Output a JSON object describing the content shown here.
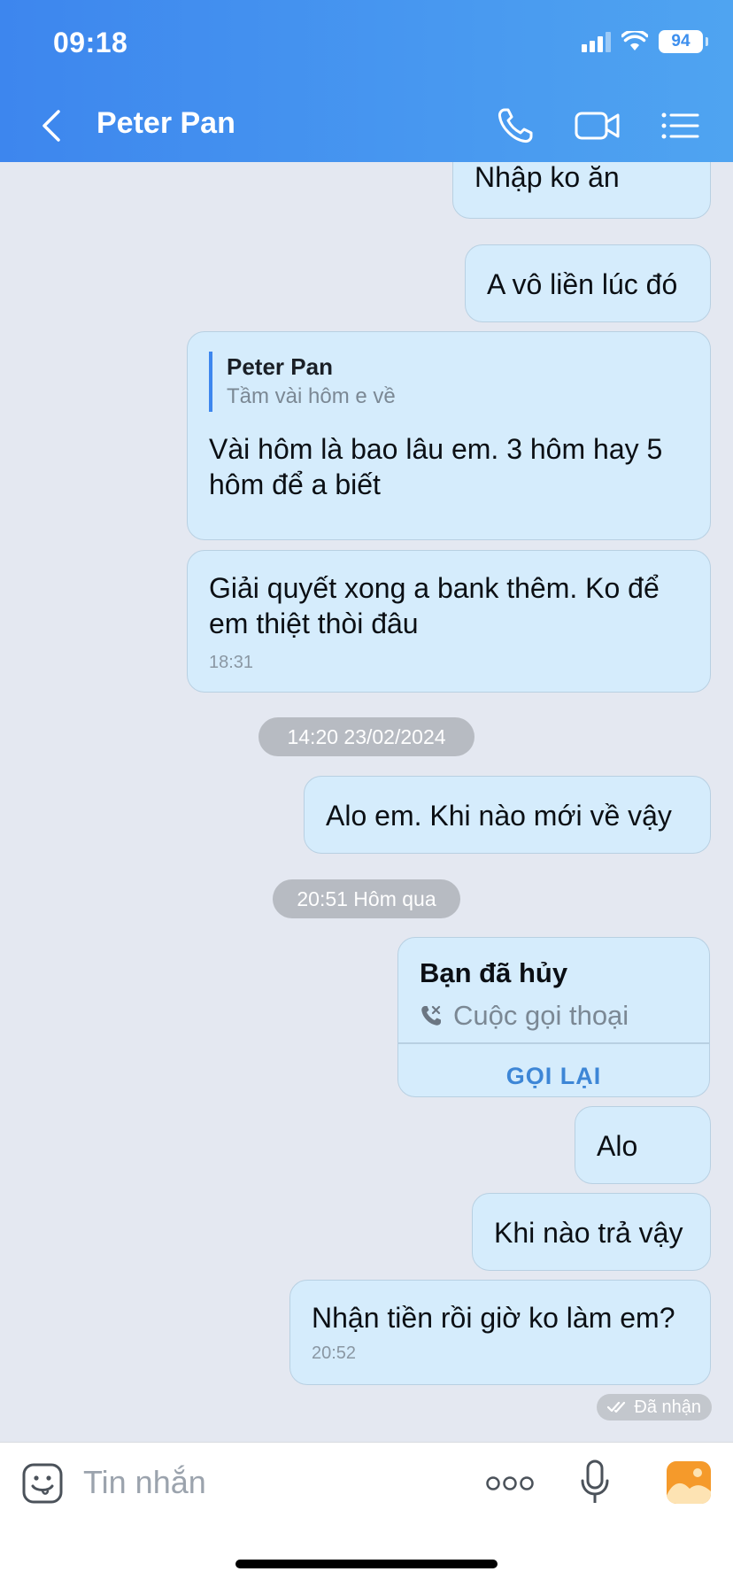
{
  "status_bar": {
    "time": "09:18",
    "battery": "94"
  },
  "header": {
    "title": "Peter Pan"
  },
  "messages": [
    {
      "text": "Nhập ko ăn"
    },
    {
      "text": "A vô liền lúc đó"
    },
    {
      "quote_name": "Peter Pan",
      "quote_text": "Tầm vài hôm e về",
      "text": "Vài hôm là bao lâu em. 3 hôm hay 5 hôm để a biết"
    },
    {
      "text": "Giải quyết xong a bank thêm. Ko để em thiệt thòi đâu",
      "time": "18:31"
    },
    {
      "text": "Alo em. Khi nào mới về vậy"
    },
    {
      "call_title": "Bạn đã hủy",
      "call_sub": "Cuộc gọi thoại",
      "call_action": "GỌI LẠI"
    },
    {
      "text": "Alo"
    },
    {
      "text": "Khi nào trả vậy"
    },
    {
      "text": "Nhận tiền rồi giờ ko làm em?",
      "time": "20:52"
    }
  ],
  "date_separators": [
    "14:20 23/02/2024",
    "20:51 Hôm qua"
  ],
  "receipt": "Đã nhận",
  "composer": {
    "placeholder": "Tin nhắn"
  },
  "colors": {
    "header_gradient_start": "#3d86ee",
    "header_gradient_end": "#4fa4f1",
    "bubble": "#d5ecfc",
    "background": "#e4e8f1",
    "accent": "#3d86d6"
  }
}
